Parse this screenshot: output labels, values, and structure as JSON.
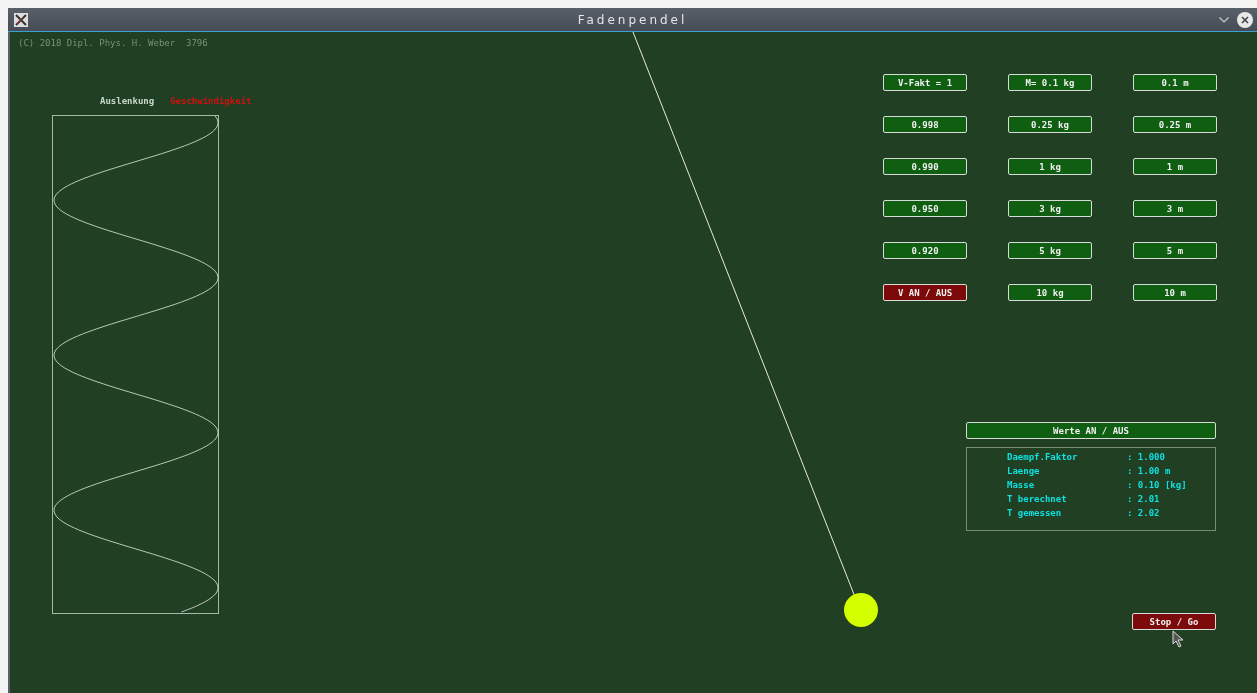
{
  "window": {
    "title": "Fadenpendel"
  },
  "copyright": "(C) 2018 Dipl. Phys. H. Weber  3796",
  "legend": [
    {
      "label": "Auslenkung",
      "color": "#c8d8c8"
    },
    {
      "label": "Geschwindigkeit",
      "color": "#d01010"
    }
  ],
  "buttons": [
    {
      "label": "V-Fakt = 1",
      "on": false
    },
    {
      "label": "M= 0.1 kg",
      "on": false
    },
    {
      "label": "0.1 m",
      "on": false
    },
    {
      "label": "0.998",
      "on": false
    },
    {
      "label": "0.25 kg",
      "on": false
    },
    {
      "label": "0.25 m",
      "on": false
    },
    {
      "label": "0.990",
      "on": false
    },
    {
      "label": "1 kg",
      "on": false
    },
    {
      "label": "1 m",
      "on": false
    },
    {
      "label": "0.950",
      "on": false
    },
    {
      "label": "3 kg",
      "on": false
    },
    {
      "label": "3 m",
      "on": false
    },
    {
      "label": "0.920",
      "on": false
    },
    {
      "label": "5 kg",
      "on": false
    },
    {
      "label": "5 m",
      "on": false
    },
    {
      "label": "V AN / AUS",
      "on": true
    },
    {
      "label": "10 kg",
      "on": false
    },
    {
      "label": "10 m",
      "on": false
    }
  ],
  "values_button": {
    "label": "Werte AN / AUS",
    "on": false
  },
  "values": [
    {
      "label": "Daempf.Faktor",
      "value": ": 1.000"
    },
    {
      "label": "Laenge",
      "value": ": 1.00 m"
    },
    {
      "label": "Masse",
      "value": ": 0.10 [kg]"
    },
    {
      "label": "T berechnet",
      "value": ": 2.01"
    },
    {
      "label": "T gemessen",
      "value": ": 2.02"
    }
  ],
  "stop_button": {
    "label": "Stop / Go",
    "on": true
  }
}
